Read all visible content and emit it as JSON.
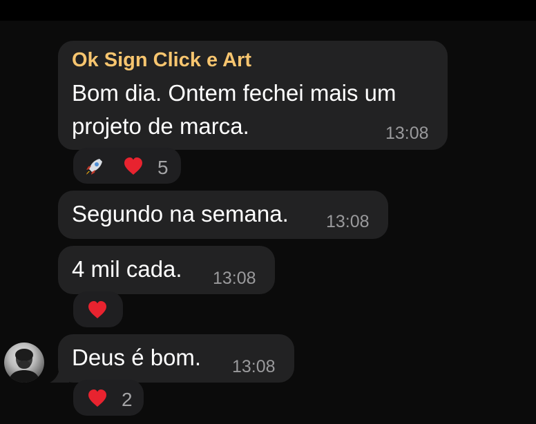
{
  "colors": {
    "background": "#0b0b0b",
    "bubble": "#222223",
    "sender_name": "#f7c56f",
    "message_text": "#ffffff",
    "timestamp": "#9a9a9c",
    "heart": "#e8232f"
  },
  "messages": [
    {
      "sender": "Ok Sign Click e Art",
      "lines": [
        "Bom dia. Ontem fechei mais um",
        "projeto de marca."
      ],
      "time": "13:08",
      "reactions": {
        "emojis": [
          "rocket-icon",
          "heart-icon"
        ],
        "count": "5"
      }
    },
    {
      "lines": [
        "Segundo na semana."
      ],
      "time": "13:08"
    },
    {
      "lines": [
        "4 mil cada."
      ],
      "time": "13:08",
      "reactions": {
        "emojis": [
          "heart-icon"
        ]
      }
    },
    {
      "lines": [
        "Deus é bom."
      ],
      "time": "13:08",
      "reactions": {
        "emojis": [
          "heart-icon"
        ],
        "count": "2"
      }
    }
  ]
}
